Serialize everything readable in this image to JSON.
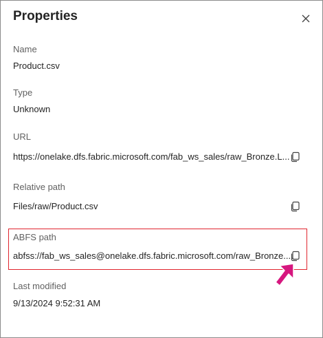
{
  "panel": {
    "title": "Properties"
  },
  "properties": [
    {
      "label": "Name",
      "value": "Product.csv"
    },
    {
      "label": "Type",
      "value": "Unknown"
    },
    {
      "label": "URL",
      "value": "https://onelake.dfs.fabric.microsoft.com/fab_ws_sales/raw_Bronze.L..."
    },
    {
      "label": "Relative path",
      "value": "Files/raw/Product.csv"
    },
    {
      "label": "ABFS path",
      "value": "abfss://fab_ws_sales@onelake.dfs.fabric.microsoft.com/raw_Bronze...."
    },
    {
      "label": "Last modified",
      "value": "9/13/2024 9:52:31 AM"
    }
  ],
  "icons": {
    "close": "close-icon",
    "copy": "copy-icon",
    "callout": "arrow-pointer-icon"
  },
  "colors": {
    "highlight": "#e0232d",
    "arrow": "#d6177f"
  }
}
